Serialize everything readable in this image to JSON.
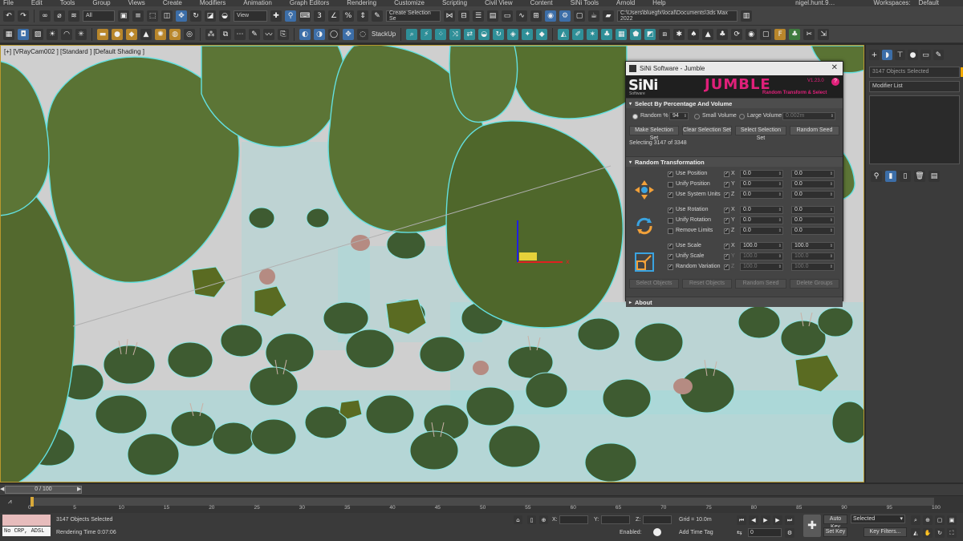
{
  "menu": {
    "items": [
      "File",
      "Edit",
      "Tools",
      "Group",
      "Views",
      "Create",
      "Modifiers",
      "Animation",
      "Graph Editors",
      "Rendering",
      "Customize",
      "Scripting",
      "Civil View",
      "Content",
      "SiNi Tools",
      "Arnold",
      "Help"
    ],
    "user": "nigel.hunt.9…",
    "workspaces_label": "Workspaces:",
    "workspaces_value": "Default"
  },
  "toolbar1": {
    "filter_value": "All",
    "view_value": "View",
    "selection_set_placeholder": "Create Selection Se",
    "project_path": "C:\\Users\\bluegfx\\local\\Documents\\3ds Max 2022"
  },
  "toolbar2": {
    "stackup_label": "StackUp"
  },
  "viewport": {
    "label": "[+] [VRayCam002 ] [Standard ] [Default Shading ]"
  },
  "command_panel": {
    "objects_selected": "3147 Objects Selected",
    "modifier_list": "Modifier List",
    "swatch_color": "#f2a900"
  },
  "dialog": {
    "title": "SiNi Software - Jumble",
    "brand": "SiNi",
    "brand_sub": "Software",
    "product": "JUMBLE",
    "tagline": "Random Transform & Select",
    "version": "V1.23.0",
    "help": "?",
    "accent": "#e0207a",
    "select_section": {
      "title": "Select By Percentage And Volume",
      "random_label": "Random %",
      "random_value": "94",
      "small_volume_label": "Small Volume",
      "large_volume_label": "Large Volume",
      "large_volume_value": "0.002m",
      "buttons": [
        "Make Selection Set",
        "Clear Selection Set",
        "Select Selection Set",
        "Random Seed"
      ],
      "selecting_text": "Selecting 3147 of 3348"
    },
    "transform_section": {
      "title": "Random Transformation",
      "position": {
        "use_label": "Use Position",
        "unify_label": "Unify Position",
        "system_label": "Use System Units",
        "x": [
          "0.0",
          "0.0"
        ],
        "y": [
          "0.0",
          "0.0"
        ],
        "z": [
          "0.0",
          "0.0"
        ]
      },
      "rotation": {
        "use_label": "Use Rotation",
        "unify_label": "Unify Rotation",
        "remove_label": "Remove Limits",
        "x": [
          "0.0",
          "0.0"
        ],
        "y": [
          "0.0",
          "0.0"
        ],
        "z": [
          "0.0",
          "0.0"
        ]
      },
      "scale": {
        "use_label": "Use Scale",
        "unify_label": "Unify Scale",
        "variation_label": "Random Variation",
        "x": [
          "100.0",
          "100.0"
        ],
        "y": [
          "100.0",
          "100.0"
        ],
        "z": [
          "100.0",
          "100.0"
        ]
      },
      "axes": [
        "X",
        "Y",
        "Z"
      ],
      "buttons": [
        "Select Objects",
        "Reset Objects",
        "Random Seed",
        "Delete Groups"
      ]
    },
    "about_title": "About"
  },
  "timeline": {
    "frame_display": "0 / 100",
    "ticks": [
      "0",
      "5",
      "10",
      "15",
      "20",
      "25",
      "30",
      "35",
      "40",
      "45",
      "50",
      "55",
      "60",
      "65",
      "70",
      "75",
      "80",
      "85",
      "90",
      "95",
      "100"
    ],
    "current_frame": 0
  },
  "status": {
    "maxscript_text": "No CRP, ADSL",
    "selection_text": "3147 Objects Selected",
    "render_time": "Rendering Time  0:07:06",
    "x_label": "X:",
    "y_label": "Y:",
    "z_label": "Z:",
    "grid_text": "Grid = 10.0m",
    "enabled_label": "Enabled:",
    "add_time_tag": "Add Time Tag",
    "auto_key": "Auto Key",
    "set_key": "Set Key",
    "selected_value": "Selected",
    "key_filters": "Key Filters...",
    "frame_field": "0"
  }
}
